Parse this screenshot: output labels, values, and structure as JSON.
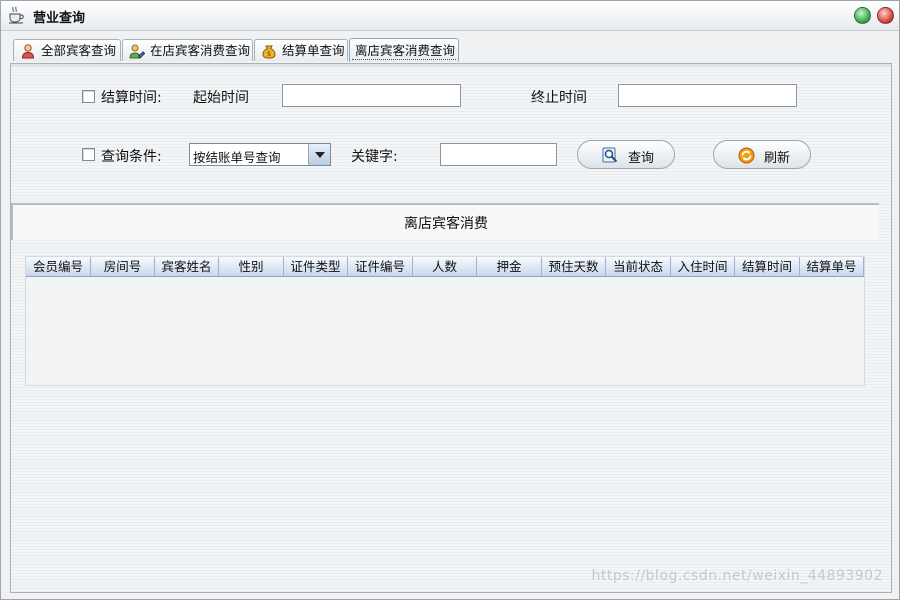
{
  "window": {
    "title": "营业查询",
    "icon": "coffee-cup-icon"
  },
  "tabs": [
    {
      "label": "全部宾客查询",
      "icon": "person-icon"
    },
    {
      "label": "在店宾客消费查询",
      "icon": "edit-user-icon"
    },
    {
      "label": "结算单查询",
      "icon": "money-bag-icon"
    },
    {
      "label": "离店宾客消费查询",
      "active": true
    }
  ],
  "filters": {
    "settle_time_label": "结算时间:",
    "start_time_label": "起始时间",
    "start_time_value": "",
    "end_time_label": "终止时间",
    "end_time_value": "",
    "condition_label": "查询条件:",
    "condition_selected": "按结账单号查询",
    "keyword_label": "关键字:",
    "keyword_value": ""
  },
  "buttons": {
    "search_label": "查询",
    "search_icon": "magnifier-icon",
    "refresh_label": "刷新",
    "refresh_icon": "refresh-icon"
  },
  "section": {
    "title": "离店宾客消费"
  },
  "table": {
    "columns": [
      "会员编号",
      "房间号",
      "宾客姓名",
      "性别",
      "证件类型",
      "证件编号",
      "人数",
      "押金",
      "预住天数",
      "当前状态",
      "入住时间",
      "结算时间",
      "结算单号"
    ],
    "rows": []
  },
  "watermark": "https://blog.csdn.net/weixin_44893902",
  "colors": {
    "header_blue": "#c7d7ea",
    "accent_blue": "#8fa7c0"
  }
}
